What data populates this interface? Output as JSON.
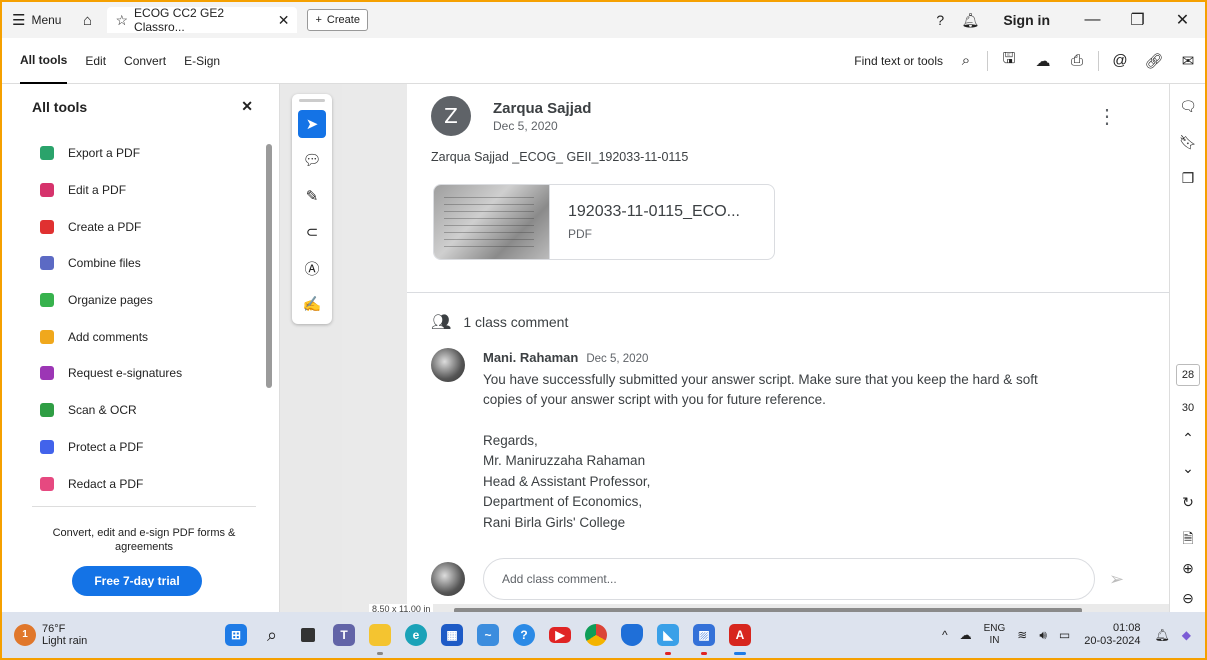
{
  "titlebar": {
    "menu_label": "Menu",
    "tab_title": "ECOG CC2 GE2 Classro...",
    "create_label": "Create",
    "signin_label": "Sign in"
  },
  "toolbar": {
    "nav": [
      "All tools",
      "Edit",
      "Convert",
      "E-Sign"
    ],
    "find_label": "Find text or tools"
  },
  "left_panel": {
    "title": "All tools",
    "items": [
      {
        "label": "Export a PDF",
        "icon": "export-pdf-icon",
        "color": "#2aa36b"
      },
      {
        "label": "Edit a PDF",
        "icon": "edit-pdf-icon",
        "color": "#d6336c"
      },
      {
        "label": "Create a PDF",
        "icon": "create-pdf-icon",
        "color": "#e03131"
      },
      {
        "label": "Combine files",
        "icon": "combine-files-icon",
        "color": "#5c6ac4"
      },
      {
        "label": "Organize pages",
        "icon": "organize-pages-icon",
        "color": "#37b24d"
      },
      {
        "label": "Add comments",
        "icon": "add-comments-icon",
        "color": "#f0a81c"
      },
      {
        "label": "Request e-signatures",
        "icon": "request-esign-icon",
        "color": "#9c36b5"
      },
      {
        "label": "Scan & OCR",
        "icon": "scan-ocr-icon",
        "color": "#2f9e44"
      },
      {
        "label": "Protect a PDF",
        "icon": "protect-pdf-icon",
        "color": "#4263eb"
      },
      {
        "label": "Redact a PDF",
        "icon": "redact-pdf-icon",
        "color": "#e64980"
      }
    ],
    "promo_text": "Convert, edit and e-sign PDF forms & agreements",
    "trial_label": "Free 7-day trial"
  },
  "post": {
    "avatar_letter": "Z",
    "author": "Zarqua Sajjad",
    "date": "Dec 5, 2020",
    "body": "Zarqua Sajjad _ECOG_ GEII_192033-11-0115",
    "attachment_title": "192033-11-0115_ECO...",
    "attachment_type": "PDF"
  },
  "comments": {
    "count_label": "1 class comment",
    "items": [
      {
        "author": "Mani. Rahaman",
        "date": "Dec 5, 2020",
        "lines": [
          "You have successfully submitted your answer script. Make sure that you keep the hard & soft",
          "copies of your answer script with you for future reference."
        ],
        "signature": [
          "Regards,",
          "Mr. Maniruzzaha Rahaman",
          "Head & Assistant Professor,",
          "Department of Economics,",
          "Rani Birla Girls' College"
        ]
      }
    ],
    "add_placeholder": "Add class comment..."
  },
  "viewer": {
    "page_size": "8.50 x 11.00 in",
    "page_current": "28",
    "page_next": "30"
  },
  "taskbar": {
    "temperature": "76°F",
    "weather": "Light rain",
    "weather_badge": "1",
    "lang_top": "ENG",
    "lang_bottom": "IN",
    "time": "01:08",
    "date": "20-03-2024"
  },
  "colors": {
    "accent": "#1473e6",
    "frame": "#f5a000"
  }
}
